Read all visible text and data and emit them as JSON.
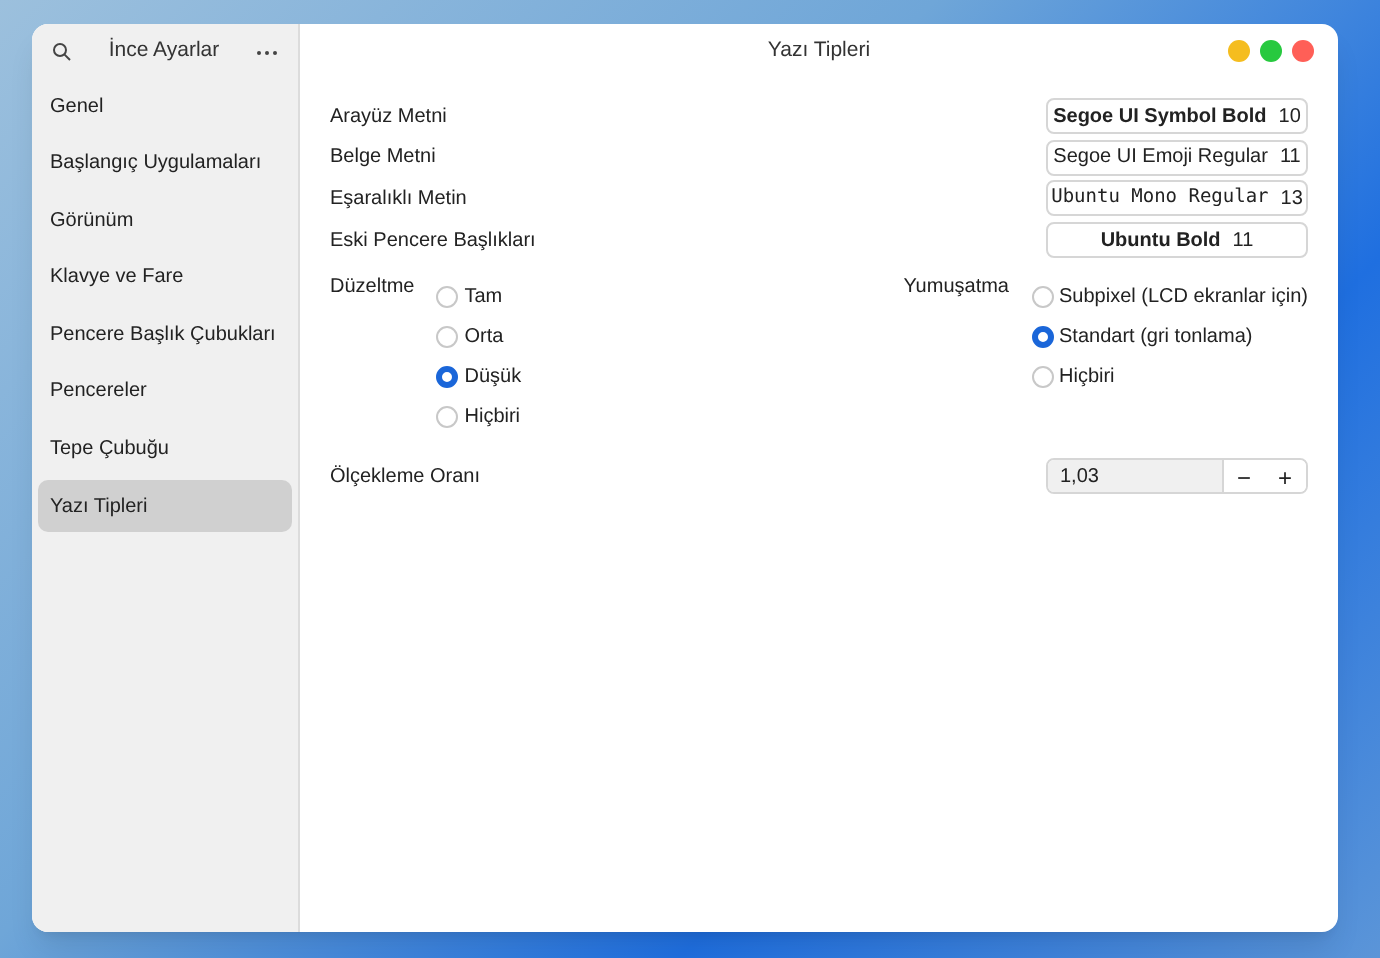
{
  "sidebar": {
    "title": "İnce Ayarlar",
    "items": [
      {
        "label": "Genel",
        "selected": false
      },
      {
        "label": "Başlangıç Uygulamaları",
        "selected": false
      },
      {
        "label": "Görünüm",
        "selected": false
      },
      {
        "label": "Klavye ve Fare",
        "selected": false
      },
      {
        "label": "Pencere Başlık Çubukları",
        "selected": false
      },
      {
        "label": "Pencereler",
        "selected": false
      },
      {
        "label": "Tepe Çubuğu",
        "selected": false
      },
      {
        "label": "Yazı Tipleri",
        "selected": true
      }
    ]
  },
  "window": {
    "title": "Yazı Tipleri"
  },
  "fonts": [
    {
      "label": "Arayüz Metni",
      "font": "Segoe UI Symbol Bold",
      "size": "10",
      "kind": "bold"
    },
    {
      "label": "Belge Metni",
      "font": "Segoe UI Emoji Regular",
      "size": "11",
      "kind": "regular"
    },
    {
      "label": "Eşaralıklı Metin",
      "font": "Ubuntu Mono Regular",
      "size": "13",
      "kind": "mono"
    },
    {
      "label": "Eski Pencere Başlıkları",
      "font": "Ubuntu Bold",
      "size": "11",
      "kind": "bold"
    }
  ],
  "hinting": {
    "label": "Düzeltme",
    "options": [
      {
        "label": "Tam",
        "selected": false
      },
      {
        "label": "Orta",
        "selected": false
      },
      {
        "label": "Düşük",
        "selected": true
      },
      {
        "label": "Hiçbiri",
        "selected": false
      }
    ]
  },
  "antialiasing": {
    "label": "Yumuşatma",
    "options": [
      {
        "label": "Subpixel (LCD ekranlar için)",
        "selected": false
      },
      {
        "label": "Standart (gri tonlama)",
        "selected": true
      },
      {
        "label": "Hiçbiri",
        "selected": false
      }
    ]
  },
  "scaling": {
    "label": "Ölçekleme Oranı",
    "value": "1,03",
    "decrement": "−",
    "increment": "+"
  }
}
